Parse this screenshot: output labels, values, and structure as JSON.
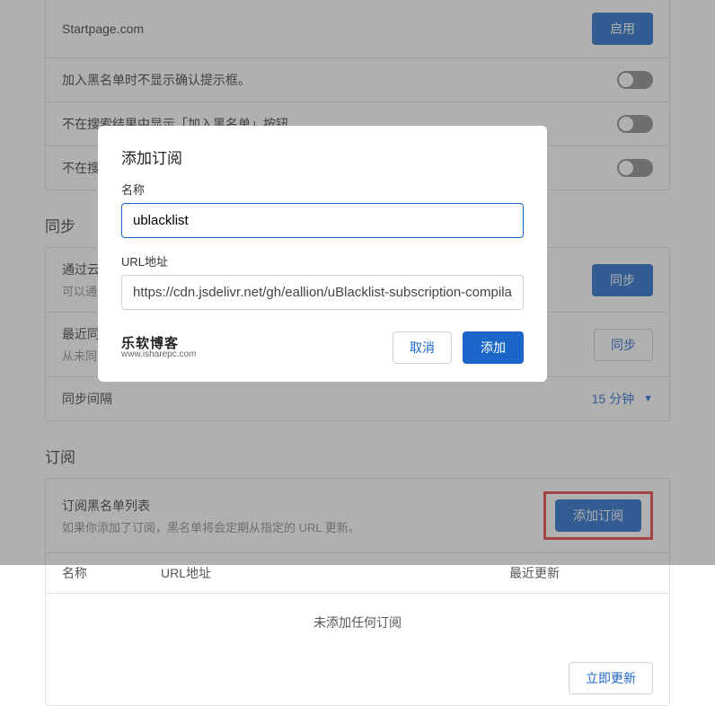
{
  "engines": {
    "startpage_label": "Startpage.com",
    "enable_btn": "启用"
  },
  "options": {
    "opt1": "加入黑名单时不显示确认提示框。",
    "opt2": "不在搜索结果中显示「加入黑名单」按钮",
    "opt3_prefix": "不在搜索"
  },
  "sync": {
    "title": "同步",
    "cloud_label": "通过云端",
    "cloud_sub_prefix": "可以通过",
    "cloud_btn_suffix": "同步",
    "last_label_prefix": "最近同步",
    "last_sub": "从未同步",
    "last_btn_suffix": "同步",
    "interval_label": "同步间隔",
    "interval_value": "15 分钟"
  },
  "subs": {
    "title": "订阅",
    "list_title": "订阅黑名单列表",
    "list_sub": "如果你添加了订阅，黑名单将会定期从指定的 URL 更新。",
    "add_btn": "添加订阅",
    "th_name": "名称",
    "th_url": "URL地址",
    "th_update": "最近更新",
    "empty": "未添加任何订阅",
    "update_now": "立即更新"
  },
  "modal": {
    "title": "添加订阅",
    "name_label": "名称",
    "name_value": "ublacklist",
    "url_label": "URL地址",
    "url_value": "https://cdn.jsdelivr.net/gh/eallion/uBlacklist-subscription-compilation@ma",
    "cancel": "取消",
    "add": "添加"
  },
  "watermark": {
    "top": "乐软博客",
    "bot": "www.isharepc.com"
  }
}
